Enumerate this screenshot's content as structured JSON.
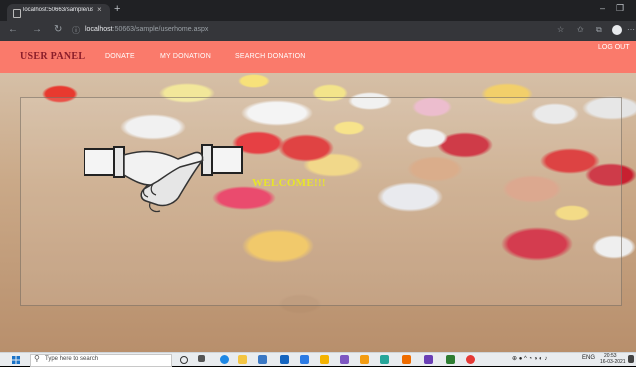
{
  "browser": {
    "tab_title": "localhost:50663/sample/userho",
    "tab_close": "×",
    "new_tab": "+",
    "window_minimize": "–",
    "window_restore": "❐",
    "back": "←",
    "forward": "→",
    "reload": "↻",
    "info_icon": "ⓘ",
    "url_host": "localhost",
    "url_path": ":50663/sample/userhome.aspx"
  },
  "header": {
    "brand": "USER PANEL",
    "nav": [
      "DONATE",
      "MY DONATION",
      "SEARCH DONATION"
    ],
    "logout": "LOG OUT"
  },
  "main": {
    "welcome": "WELCOME!!!"
  },
  "taskbar": {
    "search_placeholder": "Type here to search",
    "tray_lang": "ENG",
    "tray_time": "20:53",
    "tray_date": "16-03-2021"
  },
  "colors": {
    "header_bg": "#fa7a6b",
    "brand_color": "#8b1d2a",
    "welcome_color": "#e7e52a"
  }
}
